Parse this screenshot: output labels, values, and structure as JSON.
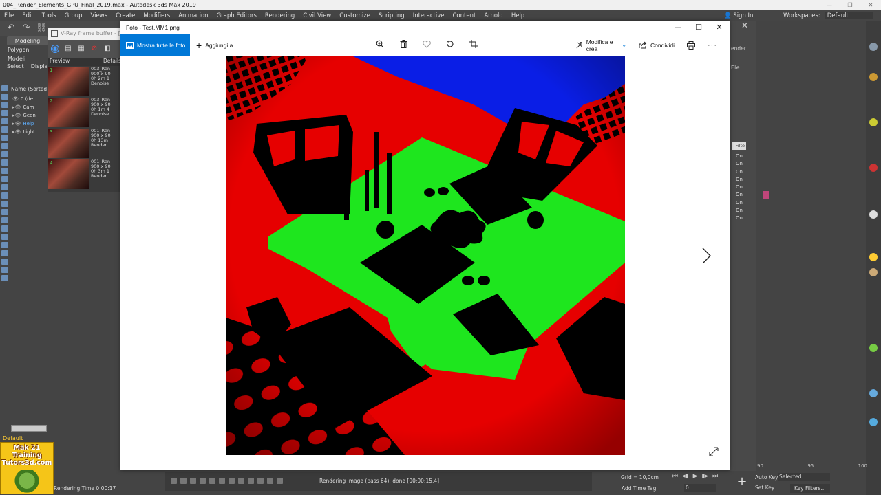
{
  "max": {
    "title": "004_Render_Elements_GPU_Final_2019.max - Autodesk 3ds Max 2019",
    "menu": [
      "File",
      "Edit",
      "Tools",
      "Group",
      "Views",
      "Create",
      "Modifiers",
      "Animation",
      "Graph Editors",
      "Rendering",
      "Civil View",
      "Customize",
      "Scripting",
      "Interactive",
      "Content",
      "Arnold",
      "Help"
    ],
    "sign_in": "Sign In",
    "workspaces_label": "Workspaces:",
    "workspace_value": "Default",
    "ribbon_tab": "Modeling",
    "ribbon_sub": "Polygon Modeli",
    "scene_tabs": [
      "Select",
      "Display"
    ],
    "explorer_header": "Name (Sorted A",
    "explorer_items": [
      "0 (de",
      "Cam",
      "Geon",
      "Help",
      "Light"
    ],
    "default_label": "Default",
    "logo_line1": "Mak 21 Training",
    "logo_line2": "Tutors3d.com",
    "render_time": "Rendering Time 0:00:17",
    "status_text": "Rendering image (pass 64): done [00:00:15,4]",
    "grid": "Grid = 10,0cm",
    "add_time_tag": "Add Time Tag",
    "auto_key": "Auto Key",
    "set_key": "Set Key",
    "selected": "Selected",
    "key_filters": "Key Filters...",
    "frame_value": "0",
    "timeline_ticks": [
      "90",
      "95",
      "100"
    ],
    "cmd_snippet": "ender",
    "file_label": "File",
    "filter_label": "Filte",
    "on_items": [
      "On",
      "On",
      "On",
      "On",
      "On",
      "On",
      "On",
      "On",
      "On"
    ]
  },
  "vfb": {
    "title": "V-Ray frame buffer - [10",
    "col_preview": "Preview",
    "col_details": "Details",
    "history": [
      {
        "num": "1",
        "lines": [
          "003_Ren",
          "900 x 90",
          "0h 2m 1",
          "Denoise"
        ]
      },
      {
        "num": "2",
        "lines": [
          "003_Ren",
          "900 x 90",
          "0h 1m 4",
          "Denoise"
        ]
      },
      {
        "num": "3",
        "lines": [
          "001_Ren",
          "900 x 90",
          "0h 13m",
          "Render"
        ]
      },
      {
        "num": "4",
        "lines": [
          "001_Ren",
          "900 x 90",
          "0h 3m 1",
          "Render"
        ]
      }
    ]
  },
  "photos": {
    "title": "Foto - Test.MM1.png",
    "show_all": "Mostra tutte le foto",
    "add_to": "Aggiungi a",
    "edit_create": "Modifica e crea",
    "share": "Condividi",
    "toolbar_icons": [
      "zoom-icon",
      "delete-icon",
      "favorite-icon",
      "rotate-icon",
      "crop-icon"
    ],
    "accent": "#0078d7"
  },
  "image_colors": {
    "red": "#e60000",
    "green": "#1ee61e",
    "blue": "#0a1ee6",
    "black": "#000000"
  }
}
